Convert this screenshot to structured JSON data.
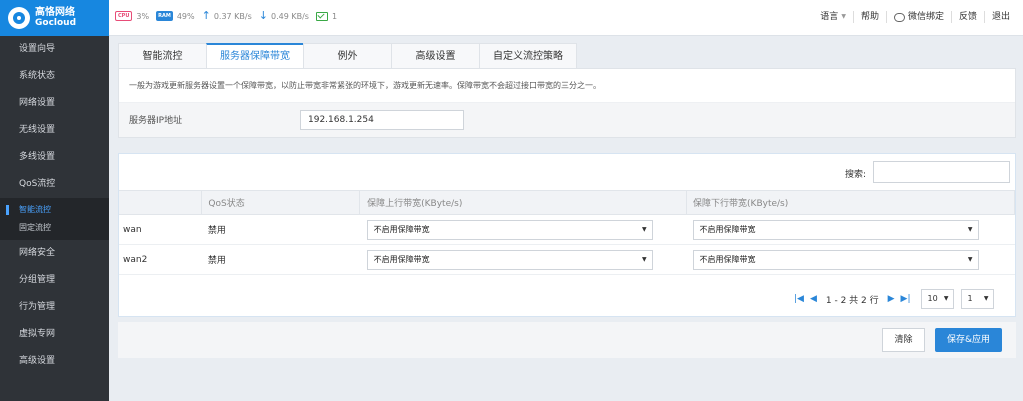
{
  "brand": {
    "name_cn": "高恪网络",
    "name_en": "Gocloud"
  },
  "stats": {
    "cpu_chip": "CPU",
    "cpu": "3%",
    "ram_chip": "RAM",
    "ram": "49%",
    "upload": "0.37 KB/s",
    "download": "0.49 KB/s",
    "online": "1"
  },
  "toplinks": {
    "language": "语言",
    "help": "帮助",
    "wechat": "微信绑定",
    "feedback": "反馈",
    "logout": "退出"
  },
  "sidebar": {
    "items": [
      "设置向导",
      "系统状态",
      "网络设置",
      "无线设置",
      "多线设置",
      "QoS流控"
    ],
    "sub": [
      "智能流控",
      "固定流控"
    ],
    "items_after": [
      "网络安全",
      "分组管理",
      "行为管理",
      "虚拟专网",
      "高级设置"
    ]
  },
  "tabs": [
    "智能流控",
    "服务器保障带宽",
    "例外",
    "高级设置",
    "自定义流控策略"
  ],
  "notice": "一般为游戏更新服务器设置一个保障带宽，以防止带宽非常紧张的环境下，游戏更新无速率。保障带宽不会超过接口带宽的三分之一。",
  "ip": {
    "label": "服务器IP地址",
    "value": "192.168.1.254"
  },
  "search": {
    "label": "搜索:"
  },
  "table": {
    "headers": [
      "",
      "QoS状态",
      "保障上行带宽(KByte/s)",
      "保障下行带宽(KByte/s)"
    ],
    "rows": [
      {
        "name": "wan",
        "status": "禁用",
        "up": "不启用保障带宽",
        "down": "不启用保障带宽"
      },
      {
        "name": "wan2",
        "status": "禁用",
        "up": "不启用保障带宽",
        "down": "不启用保障带宽"
      }
    ]
  },
  "pager": {
    "info": "1 - 2 共 2 行",
    "page_size": "10",
    "page": "1"
  },
  "buttons": {
    "clear": "清除",
    "apply": "保存&应用"
  },
  "colors": {
    "accent": "#2a86d8",
    "sidebar": "#2f3338",
    "logo": "#1787e0"
  }
}
